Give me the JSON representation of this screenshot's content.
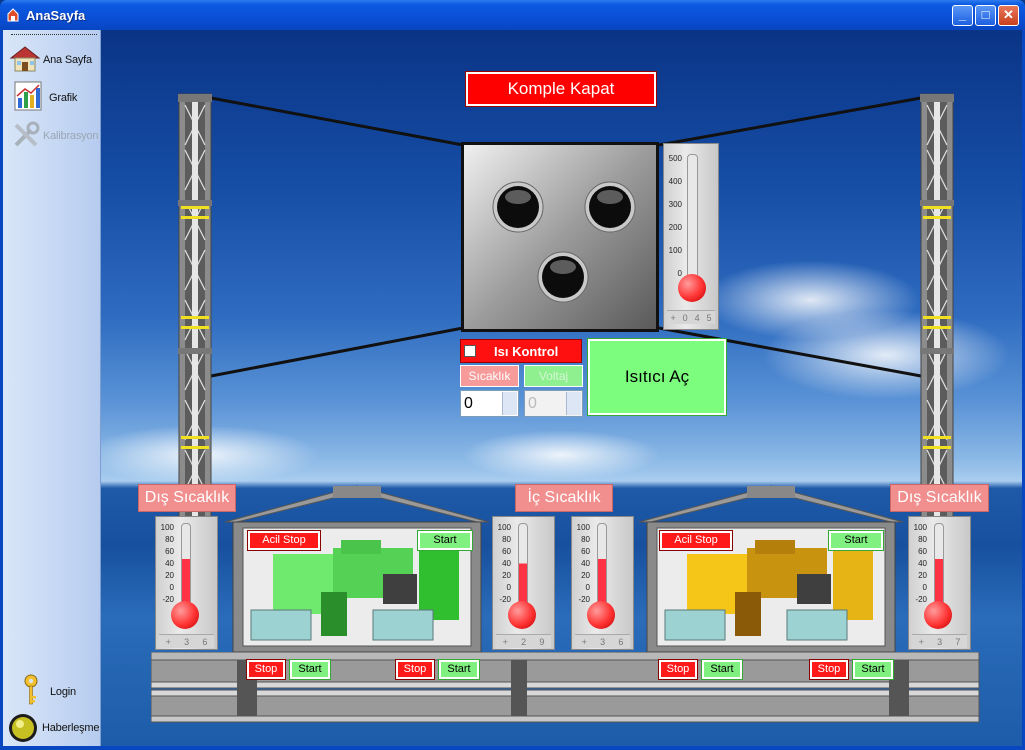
{
  "window": {
    "title": "AnaSayfa",
    "minimize": "_",
    "maximize": "□",
    "close": "✕"
  },
  "sidebar": {
    "items": [
      {
        "label": "Ana Sayfa",
        "icon": "house-icon",
        "enabled": true
      },
      {
        "label": "Grafik",
        "icon": "chart-icon",
        "enabled": true
      },
      {
        "label": "Kalibrasyon",
        "icon": "tools-icon",
        "enabled": false
      }
    ],
    "bottom": [
      {
        "label": "Login",
        "icon": "key-icon"
      },
      {
        "label": "Haberleşme",
        "icon": "status-light-icon"
      }
    ]
  },
  "main": {
    "shutdown_label": "Komple Kapat",
    "heater_control_label": "Isı Kontrol",
    "heater_control_checked": false,
    "temp_mode_label": "Sıcaklık",
    "voltage_mode_label": "Voltaj",
    "temp_value": "0",
    "voltage_value": "0",
    "heater_button_label": "Isıtıcı Aç",
    "main_thermo": {
      "ticks": [
        "500",
        "400",
        "300",
        "200",
        "100",
        "0"
      ],
      "digits": [
        "+",
        "0",
        "4",
        "5"
      ]
    },
    "outside_left_label": "Dış Sıcaklık",
    "inside_label": "İç Sıcaklık",
    "outside_right_label": "Dış Sıcaklık",
    "small_thermo_ticks": [
      "100",
      "80",
      "60",
      "40",
      "20",
      "0",
      "-20"
    ],
    "thermometers": [
      {
        "name": "outside-left",
        "digits": [
          "+",
          "3",
          "6"
        ]
      },
      {
        "name": "inside-1",
        "digits": [
          "+",
          "2",
          "9"
        ]
      },
      {
        "name": "inside-2",
        "digits": [
          "+",
          "3",
          "6"
        ]
      },
      {
        "name": "outside-right",
        "digits": [
          "+",
          "3",
          "7"
        ]
      }
    ],
    "generators": [
      {
        "emergency_stop": "Acil Stop",
        "start": "Start",
        "color": "#5fe25f"
      },
      {
        "emergency_stop": "Acil Stop",
        "start": "Start",
        "color": "#f5c518"
      }
    ],
    "rail_buttons": {
      "stop": "Stop",
      "start": "Start"
    }
  }
}
